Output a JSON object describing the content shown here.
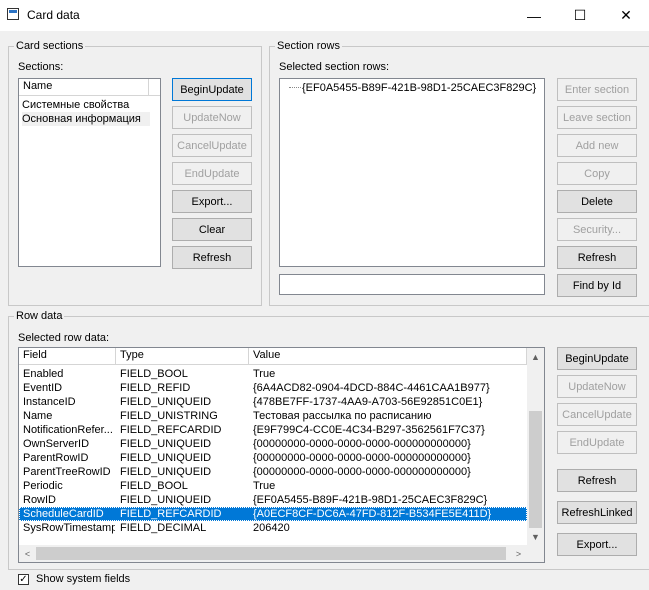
{
  "window": {
    "title": "Card data",
    "minimize": "—",
    "maximize": "☐",
    "close": "✕"
  },
  "card_sections": {
    "group_label": "Card sections",
    "list_label": "Sections:",
    "column": "Name",
    "items": [
      "Системные свойства",
      "Основная информация"
    ],
    "buttons": {
      "begin": "BeginUpdate",
      "update_now": "UpdateNow",
      "cancel": "CancelUpdate",
      "end": "EndUpdate",
      "export": "Export...",
      "clear": "Clear",
      "refresh": "Refresh"
    }
  },
  "section_rows": {
    "group_label": "Section rows",
    "list_label": "Selected section rows:",
    "tree_item": "{EF0A5455-B89F-421B-98D1-25CAEC3F829C}",
    "input_value": "",
    "buttons": {
      "enter": "Enter section",
      "leave": "Leave section",
      "add": "Add new",
      "copy": "Copy",
      "delete": "Delete",
      "security": "Security...",
      "refresh": "Refresh",
      "find": "Find by Id"
    }
  },
  "row_data": {
    "group_label": "Row data",
    "list_label": "Selected row data:",
    "columns": [
      "Field",
      "Type",
      "Value"
    ],
    "rows": [
      {
        "field": "Enabled",
        "type": "FIELD_BOOL",
        "value": "True"
      },
      {
        "field": "EventID",
        "type": "FIELD_REFID",
        "value": "{6A4ACD82-0904-4DCD-884C-4461CAA1B977}"
      },
      {
        "field": "InstanceID",
        "type": "FIELD_UNIQUEID",
        "value": "{478BE7FF-1737-4AA9-A703-56E92851C0E1}"
      },
      {
        "field": "Name",
        "type": "FIELD_UNISTRING",
        "value": "Тестовая рассылка по расписанию"
      },
      {
        "field": "NotificationRefer...",
        "type": "FIELD_REFCARDID",
        "value": "{E9F799C4-CC0E-4C34-B297-3562561F7C37}"
      },
      {
        "field": "OwnServerID",
        "type": "FIELD_UNIQUEID",
        "value": "{00000000-0000-0000-0000-000000000000}"
      },
      {
        "field": "ParentRowID",
        "type": "FIELD_UNIQUEID",
        "value": "{00000000-0000-0000-0000-000000000000}"
      },
      {
        "field": "ParentTreeRowID",
        "type": "FIELD_UNIQUEID",
        "value": "{00000000-0000-0000-0000-000000000000}"
      },
      {
        "field": "Periodic",
        "type": "FIELD_BOOL",
        "value": "True"
      },
      {
        "field": "RowID",
        "type": "FIELD_UNIQUEID",
        "value": "{EF0A5455-B89F-421B-98D1-25CAEC3F829C}"
      },
      {
        "field": "ScheduleCardID",
        "type": "FIELD_REFCARDID",
        "value": "{A0ECF8CF-DC6A-47FD-812F-B534FE5E411D}",
        "selected": true
      },
      {
        "field": "SysRowTimestamp",
        "type": "FIELD_DECIMAL",
        "value": "206420"
      }
    ],
    "buttons": {
      "begin": "BeginUpdate",
      "update_now": "UpdateNow",
      "cancel": "CancelUpdate",
      "end": "EndUpdate",
      "refresh": "Refresh",
      "refresh_linked": "RefreshLinked",
      "export": "Export..."
    }
  },
  "footer": {
    "show_system_fields": "Show system fields",
    "show_system_fields_checked": true,
    "check_mark": "✓"
  },
  "icons": {
    "scroll_up": "▲",
    "scroll_down": "▼",
    "scroll_left": "<",
    "scroll_right": ">"
  }
}
